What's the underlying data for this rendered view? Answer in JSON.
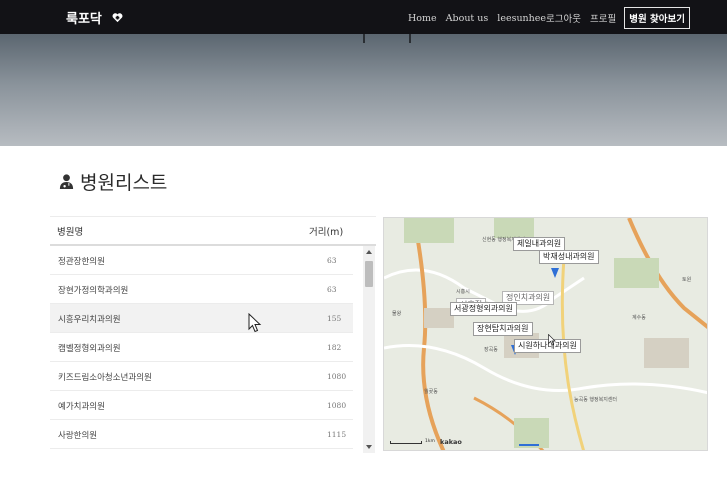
{
  "navbar": {
    "brand": "룩포닥",
    "items": [
      "Home",
      "About us",
      "leesunhee",
      "로그아웃",
      "프로필"
    ],
    "cta": "병원 찾아보기"
  },
  "section": {
    "title": "병원리스트"
  },
  "table": {
    "headers": {
      "name": "병원명",
      "distance": "거리(m)"
    },
    "rows": [
      {
        "name": "정관장한의원",
        "distance": "63"
      },
      {
        "name": "장현가정의학과의원",
        "distance": "63"
      },
      {
        "name": "시흥우리치과의원",
        "distance": "155"
      },
      {
        "name": "캠벨정형외과의원",
        "distance": "182"
      },
      {
        "name": "키즈드림소아청소년과의원",
        "distance": "1080"
      },
      {
        "name": "예가치과의원",
        "distance": "1080"
      },
      {
        "name": "사랑한의원",
        "distance": "1115"
      }
    ]
  },
  "map": {
    "labels": [
      "제일내과의원",
      "박재성내과의원",
      "서광정형외과의원",
      "장현탑치과의원",
      "시원하나내과의원"
    ],
    "ghost_labels": [
      "정인치과의원",
      "시흥점"
    ],
    "places": [
      "신현동 행정복지센터",
      "월곶동",
      "능곡동 행정복지센터",
      "토원",
      "시흥시",
      "물왕",
      "장곡동",
      "계수동"
    ],
    "scale": "1km",
    "logo": "kakao"
  },
  "colors": {
    "navbar": "#121216",
    "hero_top": "#5b6670",
    "hero_bottom": "#b7bcc1",
    "map_bg": "#e8ebe2",
    "road_orange": "#e6a25a",
    "marker_blue": "#2f6fd6"
  },
  "icons": [
    "heart-icon",
    "doctor-icon",
    "cursor-icon",
    "map-marker-icon"
  ]
}
